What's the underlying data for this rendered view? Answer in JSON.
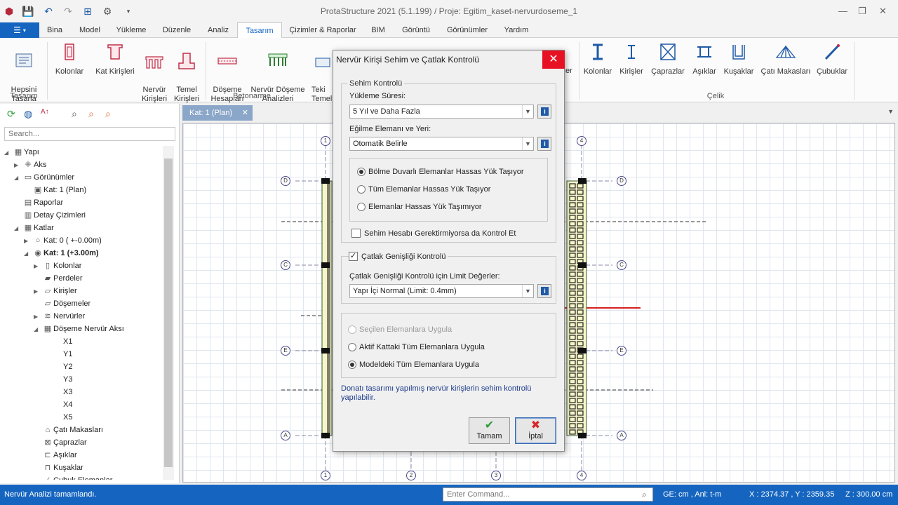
{
  "app": {
    "title": "ProtaStructure 2021 (5.1.199) / Proje: Egitim_kaset-nervurdoseme_1",
    "colors": {
      "accent": "#1565c0",
      "close": "#e81123",
      "ok_green": "#2e9e3a",
      "cancel_red": "#d62828"
    }
  },
  "quick_access": [
    "app-logo-icon",
    "save-icon",
    "undo-icon",
    "redo-icon",
    "structure-icon",
    "settings-icon",
    "customize-icon"
  ],
  "menu": {
    "file_icon": "☰",
    "tabs": [
      "Bina",
      "Model",
      "Yükleme",
      "Düzenle",
      "Analiz",
      "Tasarım",
      "Çizimler & Raporlar",
      "BIM",
      "Görüntü",
      "Görünümler",
      "Yardım"
    ],
    "active": "Tasarım"
  },
  "ribbon": {
    "groups": {
      "tasarim": "Tasarım",
      "betonarme": "Betonarme",
      "celik": "Çelik"
    },
    "buttons": {
      "hepsini": "Hepsini\nTasarla",
      "kolonlar": "Kolonlar",
      "kat_kirisleri": "Kat Kirişleri",
      "nervur_kirisleri": "Nervür\nKirişleri",
      "temel_kirisleri": "Temel\nKirişleri",
      "doseme_hesaplari": "Döşeme\nHesapları",
      "nervur_doseme": "Nervür Döşeme\nAnalizleri",
      "teki": "Teki\nTemel",
      "er": "er",
      "s_kolonlar": "Kolonlar",
      "s_kirisler": "Kirişler",
      "s_caprazlar": "Çaprazlar",
      "s_asiklar": "Aşıklar",
      "s_kusaklar": "Kuşaklar",
      "s_cati": "Çatı Makasları",
      "s_cubuklar": "Çubuklar"
    }
  },
  "left_panel": {
    "search_placeholder": "Search...",
    "tree": [
      {
        "label": "Yapı",
        "level": 0,
        "expander": "◢",
        "icon": "▦"
      },
      {
        "label": "Aks",
        "level": 1,
        "expander": "▶",
        "icon": "⁜"
      },
      {
        "label": "Görünümler",
        "level": 1,
        "expander": "◢",
        "icon": "▭"
      },
      {
        "label": "Kat: 1 (Plan)",
        "level": 2,
        "expander": "",
        "icon": "▣"
      },
      {
        "label": "Raporlar",
        "level": 1,
        "expander": "",
        "icon": "▤"
      },
      {
        "label": "Detay Çizimleri",
        "level": 1,
        "expander": "",
        "icon": "▥"
      },
      {
        "label": "Katlar",
        "level": 1,
        "expander": "◢",
        "icon": "▦"
      },
      {
        "label": "Kat: 0 ( +-0.00m)",
        "level": 2,
        "expander": "▶",
        "icon": "○"
      },
      {
        "label": "Kat: 1 (+3.00m)",
        "level": 2,
        "expander": "◢",
        "icon": "◉",
        "bold": true
      },
      {
        "label": "Kolonlar",
        "level": 3,
        "expander": "▶",
        "icon": "▯"
      },
      {
        "label": "Perdeler",
        "level": 3,
        "expander": "",
        "icon": "▰"
      },
      {
        "label": "Kirişler",
        "level": 3,
        "expander": "▶",
        "icon": "▱"
      },
      {
        "label": "Döşemeler",
        "level": 3,
        "expander": "",
        "icon": "▱"
      },
      {
        "label": "Nervürler",
        "level": 3,
        "expander": "▶",
        "icon": "≋"
      },
      {
        "label": "Döşeme Nervür Aksı",
        "level": 3,
        "expander": "◢",
        "icon": "▦"
      },
      {
        "label": "X1",
        "level": 4,
        "expander": "",
        "icon": ""
      },
      {
        "label": "Y1",
        "level": 4,
        "expander": "",
        "icon": ""
      },
      {
        "label": "Y2",
        "level": 4,
        "expander": "",
        "icon": ""
      },
      {
        "label": "Y3",
        "level": 4,
        "expander": "",
        "icon": ""
      },
      {
        "label": "X3",
        "level": 4,
        "expander": "",
        "icon": ""
      },
      {
        "label": "X4",
        "level": 4,
        "expander": "",
        "icon": ""
      },
      {
        "label": "X5",
        "level": 4,
        "expander": "",
        "icon": ""
      },
      {
        "label": "Çatı Makasları",
        "level": 3,
        "expander": "",
        "icon": "⌂"
      },
      {
        "label": "Çaprazlar",
        "level": 3,
        "expander": "",
        "icon": "⊠"
      },
      {
        "label": "Aşıklar",
        "level": 3,
        "expander": "",
        "icon": "⊏"
      },
      {
        "label": "Kuşaklar",
        "level": 3,
        "expander": "",
        "icon": "⊓"
      },
      {
        "label": "Çubuk Elemanlar",
        "level": 3,
        "expander": "",
        "icon": "⁄"
      }
    ]
  },
  "document": {
    "tab_label": "Kat: 1 (Plan)",
    "axes_top": [
      "1",
      "4"
    ],
    "axes_bottom": [
      "1",
      "2",
      "3",
      "4"
    ],
    "axes_left": [
      "D",
      "C",
      "E",
      "A"
    ],
    "axes_right": [
      "D",
      "C",
      "E",
      "A"
    ]
  },
  "dialog": {
    "title": "Nervür Kirişi Sehim ve Çatlak Kontrolü",
    "sehim_group": "Sehim Kontrolü",
    "yukleme_label": "Yükleme Süresi:",
    "yukleme_value": "5 Yıl ve Daha Fazla",
    "egilme_label": "Eğilme Elemanı ve Yeri:",
    "egilme_value": "Otomatik Belirle",
    "radios_a": [
      {
        "label": "Bölme Duvarlı Elemanlar Hassas Yük Taşıyor",
        "selected": true
      },
      {
        "label": "Tüm Elemanlar Hassas Yük Taşıyor",
        "selected": false
      },
      {
        "label": "Elemanlar Hassas Yük Taşımıyor",
        "selected": false
      }
    ],
    "sehim_check": "Sehim Hesabı Gerektirmiyorsa da Kontrol Et",
    "catlak_check": "Çatlak Genişliği Kontrolü",
    "catlak_label": "Çatlak Genişliği Kontrolü için Limit Değerler:",
    "catlak_value": "Yapı İçi Normal (Limit: 0.4mm)",
    "radios_b": [
      {
        "label": "Seçilen Elemanlara Uygula",
        "selected": false,
        "disabled": true
      },
      {
        "label": "Aktif Kattaki Tüm Elemanlara Uygula",
        "selected": false,
        "disabled": false
      },
      {
        "label": "Modeldeki Tüm Elemanlara Uygula",
        "selected": true,
        "disabled": false
      }
    ],
    "note": "Donatı tasarımı yapılmış nervür kirişlerin sehim kontrolü yapılabilir.",
    "ok": "Tamam",
    "cancel": "İptal"
  },
  "status": {
    "message": "Nervür Analizi tamamlandı.",
    "command_placeholder": "Enter Command...",
    "units": "GE: cm , Anl: t-m",
    "coords": "X : 2374.37 , Y : 2359.35",
    "z": "Z : 300.00 cm"
  }
}
